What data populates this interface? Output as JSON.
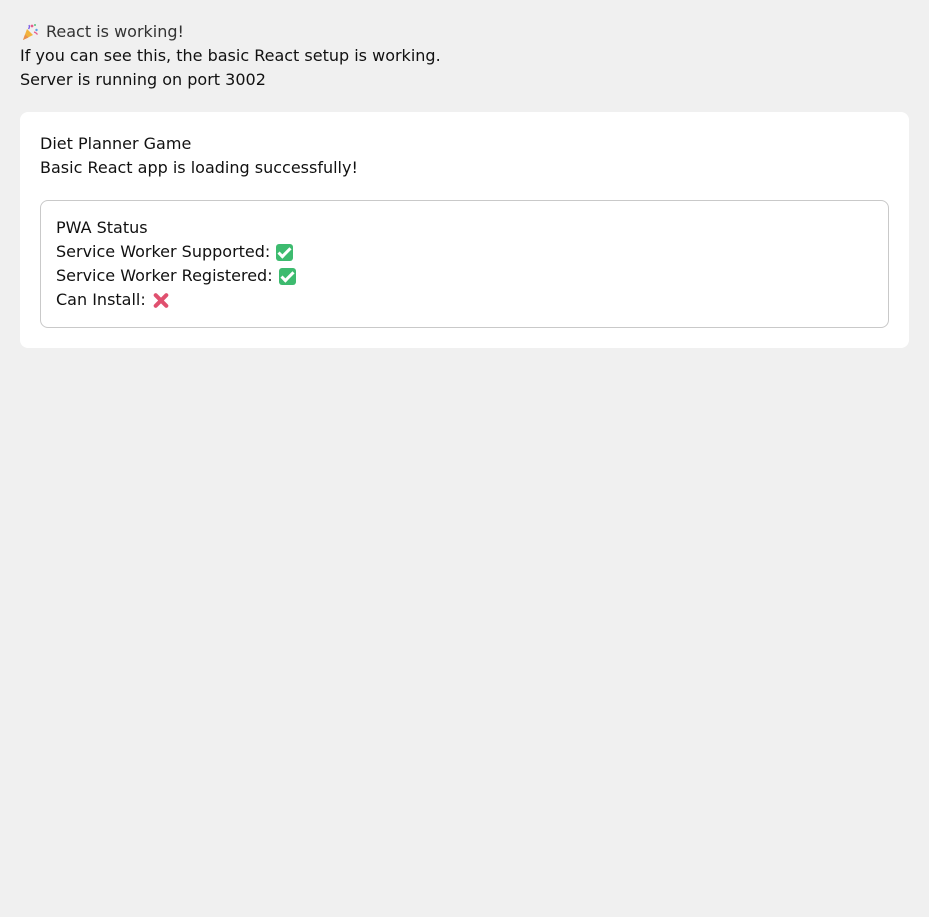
{
  "banner": {
    "icon": "party-popper-icon",
    "title": "React is working!",
    "line1": "If you can see this, the basic React setup is working.",
    "line2": "Server is running on port 3002"
  },
  "card": {
    "title": "Diet Planner Game",
    "subtitle": "Basic React app is loading successfully!"
  },
  "pwa": {
    "title": "PWA Status",
    "rows": [
      {
        "label": "Service Worker Supported:",
        "status": "yes",
        "icon": "check-mark-icon"
      },
      {
        "label": "Service Worker Registered:",
        "status": "yes",
        "icon": "check-mark-icon"
      },
      {
        "label": "Can Install:",
        "status": "no",
        "icon": "cross-mark-icon"
      }
    ]
  },
  "colors": {
    "page_bg": "#f0f0f0",
    "card_bg": "#ffffff",
    "check": "#3dbb6f",
    "cross": "#e0506f"
  }
}
